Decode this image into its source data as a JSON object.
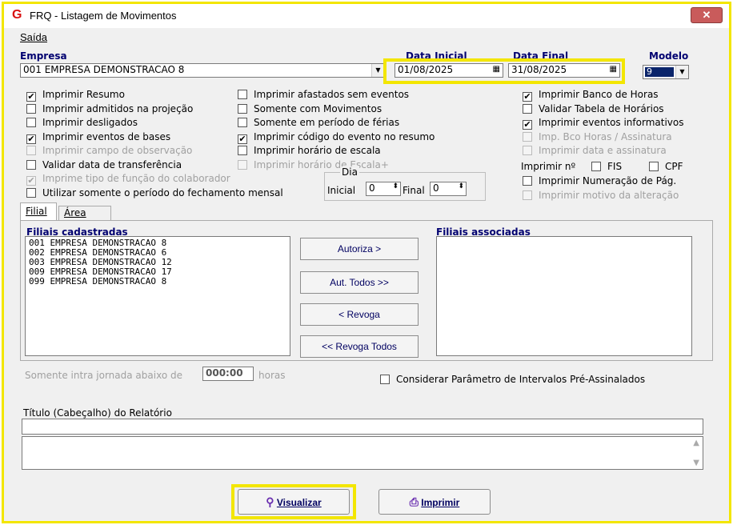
{
  "window": {
    "title": "FRQ - Listagem de Movimentos",
    "close_icon": "close-icon"
  },
  "menu": {
    "saida": "Saída"
  },
  "empresa": {
    "label": "Empresa",
    "value": "001 EMPRESA DEMONSTRACAO 8"
  },
  "data_inicial": {
    "label": "Data Inicial",
    "value": "01/08/2025"
  },
  "data_final": {
    "label": "Data Final",
    "value": "31/08/2025"
  },
  "modelo": {
    "label": "Modelo",
    "value": "9"
  },
  "options_col1": [
    {
      "label": "Imprimir Resumo",
      "checked": true,
      "enabled": true
    },
    {
      "label": "Imprimir admitidos na projeção",
      "checked": false,
      "enabled": true
    },
    {
      "label": "Imprimir desligados",
      "checked": false,
      "enabled": true
    },
    {
      "label": "Imprimir eventos de bases",
      "checked": true,
      "enabled": true
    },
    {
      "label": "Imprimir campo de observação",
      "checked": false,
      "enabled": false
    },
    {
      "label": "Validar data de transferência",
      "checked": false,
      "enabled": true
    },
    {
      "label": "Imprime tipo de função do colaborador",
      "checked": true,
      "enabled": false
    },
    {
      "label": "Utilizar somente o período do fechamento mensal",
      "checked": false,
      "enabled": true
    }
  ],
  "options_col2": [
    {
      "label": "Imprimir afastados sem eventos",
      "checked": false,
      "enabled": true
    },
    {
      "label": "Somente com Movimentos",
      "checked": false,
      "enabled": true
    },
    {
      "label": "Somente em período de férias",
      "checked": false,
      "enabled": true
    },
    {
      "label": "Imprimir código do evento no resumo",
      "checked": true,
      "enabled": true
    },
    {
      "label": "Imprimir horário de escala",
      "checked": false,
      "enabled": true
    },
    {
      "label": "Imprimir horário de Escala+",
      "checked": false,
      "enabled": false
    }
  ],
  "options_col3": [
    {
      "label": "Imprimir Banco de Horas",
      "checked": true,
      "enabled": true
    },
    {
      "label": "Validar Tabela de Horários",
      "checked": false,
      "enabled": true
    },
    {
      "label": "Imprimir eventos informativos",
      "checked": true,
      "enabled": true
    },
    {
      "label": "Imp. Bco Horas / Assinatura",
      "checked": false,
      "enabled": false
    },
    {
      "label": "Imprimir data e assinatura",
      "checked": false,
      "enabled": false
    }
  ],
  "imprimir_n": {
    "label": "Imprimir nº",
    "fis": "FIS",
    "cpf": "CPF"
  },
  "options_col3b": [
    {
      "label": "Imprimir Numeração de Pág.",
      "checked": false,
      "enabled": true
    },
    {
      "label": "Imprimir motivo da alteração",
      "checked": false,
      "enabled": false
    }
  ],
  "dia": {
    "label": "Dia",
    "inicial_label": "Inicial",
    "inicial_value": "0",
    "final_label": "Final",
    "final_value": "0"
  },
  "tabs": [
    {
      "label": "Filial"
    },
    {
      "label": "Área"
    }
  ],
  "filiais_cadastradas": {
    "label": "Filiais cadastradas",
    "items": [
      "001 EMPRESA DEMONSTRACAO 8",
      "002 EMPRESA DEMONSTRACAO 6",
      "003 EMPRESA DEMONSTRACAO 12",
      "009 EMPRESA DEMONSTRACAO 17",
      "099 EMPRESA DEMONSTRACAO 8"
    ]
  },
  "filiais_associadas": {
    "label": "Filiais associadas"
  },
  "buttons": {
    "autoriza": "Autoriza >",
    "aut_todos": "Aut. Todos >>",
    "revoga": "< Revoga",
    "revoga_todos": "<< Revoga Todos"
  },
  "intra": {
    "label": "Somente intra jornada abaixo de",
    "value": "000:00",
    "suffix": "horas"
  },
  "considerar": {
    "label": "Considerar Parâmetro de Intervalos Pré-Assinalados"
  },
  "titulo": {
    "label": "Título (Cabeçalho) do Relatório"
  },
  "actions": {
    "visualizar": "Visualizar",
    "imprimir": "Imprimir"
  },
  "colors": {
    "highlight": "#f3e600",
    "label_blue": "#000070",
    "close_red": "#c95b5b"
  }
}
